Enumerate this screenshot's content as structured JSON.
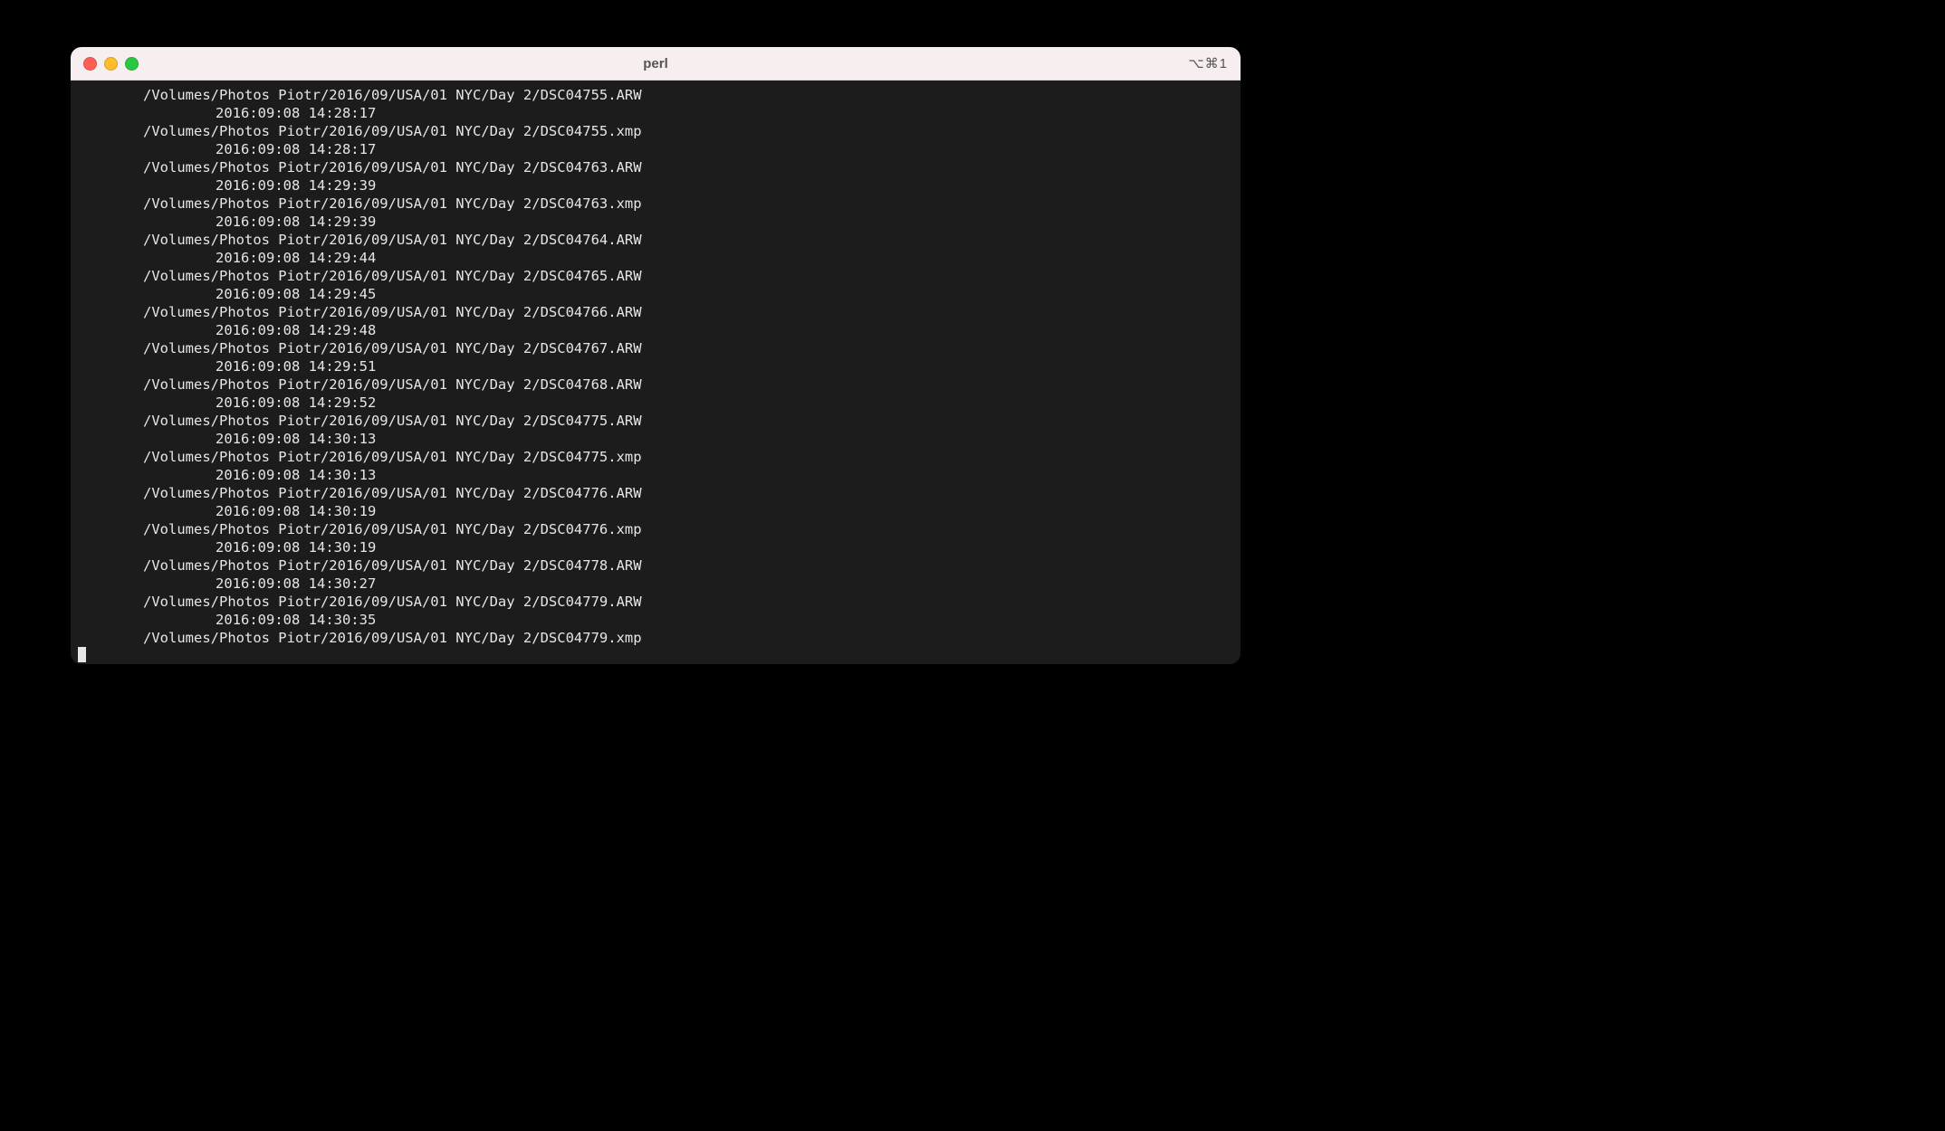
{
  "window": {
    "title": "perl",
    "shortcut": "⌥⌘1"
  },
  "terminal": {
    "lines": [
      {
        "type": "path",
        "text": "/Volumes/Photos Piotr/2016/09/USA/01 NYC/Day 2/DSC04755.ARW"
      },
      {
        "type": "ts",
        "text": "2016:09:08 14:28:17"
      },
      {
        "type": "path",
        "text": "/Volumes/Photos Piotr/2016/09/USA/01 NYC/Day 2/DSC04755.xmp"
      },
      {
        "type": "ts",
        "text": "2016:09:08 14:28:17"
      },
      {
        "type": "path",
        "text": "/Volumes/Photos Piotr/2016/09/USA/01 NYC/Day 2/DSC04763.ARW"
      },
      {
        "type": "ts",
        "text": "2016:09:08 14:29:39"
      },
      {
        "type": "path",
        "text": "/Volumes/Photos Piotr/2016/09/USA/01 NYC/Day 2/DSC04763.xmp"
      },
      {
        "type": "ts",
        "text": "2016:09:08 14:29:39"
      },
      {
        "type": "path",
        "text": "/Volumes/Photos Piotr/2016/09/USA/01 NYC/Day 2/DSC04764.ARW"
      },
      {
        "type": "ts",
        "text": "2016:09:08 14:29:44"
      },
      {
        "type": "path",
        "text": "/Volumes/Photos Piotr/2016/09/USA/01 NYC/Day 2/DSC04765.ARW"
      },
      {
        "type": "ts",
        "text": "2016:09:08 14:29:45"
      },
      {
        "type": "path",
        "text": "/Volumes/Photos Piotr/2016/09/USA/01 NYC/Day 2/DSC04766.ARW"
      },
      {
        "type": "ts",
        "text": "2016:09:08 14:29:48"
      },
      {
        "type": "path",
        "text": "/Volumes/Photos Piotr/2016/09/USA/01 NYC/Day 2/DSC04767.ARW"
      },
      {
        "type": "ts",
        "text": "2016:09:08 14:29:51"
      },
      {
        "type": "path",
        "text": "/Volumes/Photos Piotr/2016/09/USA/01 NYC/Day 2/DSC04768.ARW"
      },
      {
        "type": "ts",
        "text": "2016:09:08 14:29:52"
      },
      {
        "type": "path",
        "text": "/Volumes/Photos Piotr/2016/09/USA/01 NYC/Day 2/DSC04775.ARW"
      },
      {
        "type": "ts",
        "text": "2016:09:08 14:30:13"
      },
      {
        "type": "path",
        "text": "/Volumes/Photos Piotr/2016/09/USA/01 NYC/Day 2/DSC04775.xmp"
      },
      {
        "type": "ts",
        "text": "2016:09:08 14:30:13"
      },
      {
        "type": "path",
        "text": "/Volumes/Photos Piotr/2016/09/USA/01 NYC/Day 2/DSC04776.ARW"
      },
      {
        "type": "ts",
        "text": "2016:09:08 14:30:19"
      },
      {
        "type": "path",
        "text": "/Volumes/Photos Piotr/2016/09/USA/01 NYC/Day 2/DSC04776.xmp"
      },
      {
        "type": "ts",
        "text": "2016:09:08 14:30:19"
      },
      {
        "type": "path",
        "text": "/Volumes/Photos Piotr/2016/09/USA/01 NYC/Day 2/DSC04778.ARW"
      },
      {
        "type": "ts",
        "text": "2016:09:08 14:30:27"
      },
      {
        "type": "path",
        "text": "/Volumes/Photos Piotr/2016/09/USA/01 NYC/Day 2/DSC04779.ARW"
      },
      {
        "type": "ts",
        "text": "2016:09:08 14:30:35"
      },
      {
        "type": "path",
        "text": "/Volumes/Photos Piotr/2016/09/USA/01 NYC/Day 2/DSC04779.xmp"
      }
    ]
  }
}
